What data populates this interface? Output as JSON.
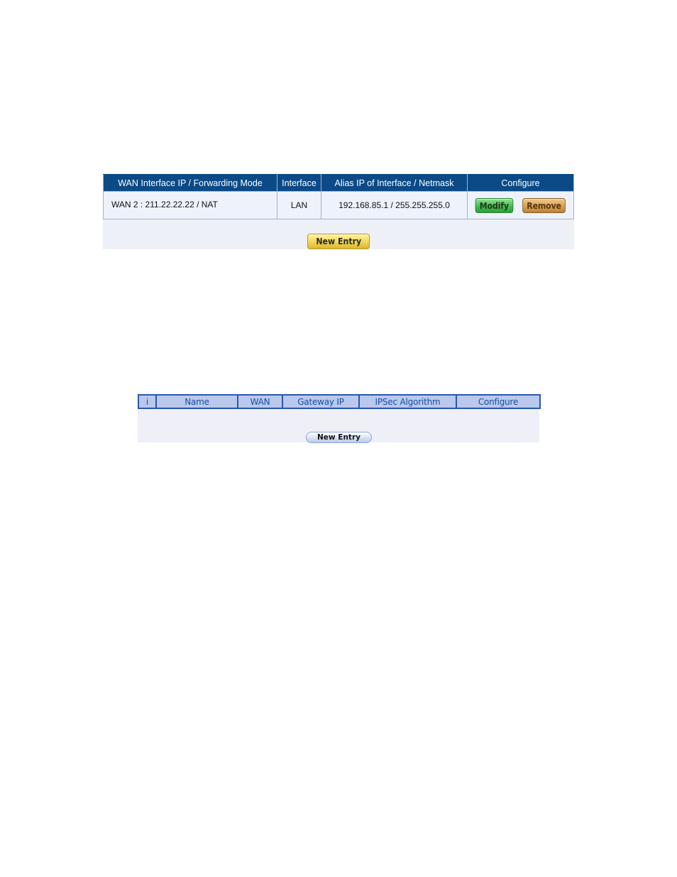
{
  "subnet_table": {
    "headers": [
      "WAN Interface IP / Forwarding Mode",
      "Interface",
      "Alias IP of Interface / Netmask",
      "Configure"
    ],
    "rows": [
      {
        "wan": "WAN 2 : 211.22.22.22 / NAT",
        "interface": "LAN",
        "alias": "192.168.85.1 / 255.255.255.0",
        "modify_label": "Modify",
        "remove_label": "Remove"
      }
    ],
    "new_entry_label": "New Entry",
    "colors": {
      "header_bg": "#0b4a86",
      "header_text": "#ffffff",
      "row_bg": "#eef2fa",
      "modify_button": "#3fb84a",
      "remove_button": "#d59d52",
      "new_entry_button": "#f0d55a"
    }
  },
  "vpn_table": {
    "headers": [
      "i",
      "Name",
      "WAN",
      "Gateway IP",
      "IPSec Algorithm",
      "Configure"
    ],
    "rows": [],
    "new_entry_label": "New Entry",
    "colors": {
      "header_bg": "#b9c8ec",
      "header_text": "#1a4ea3",
      "border": "#2b58a8"
    }
  }
}
